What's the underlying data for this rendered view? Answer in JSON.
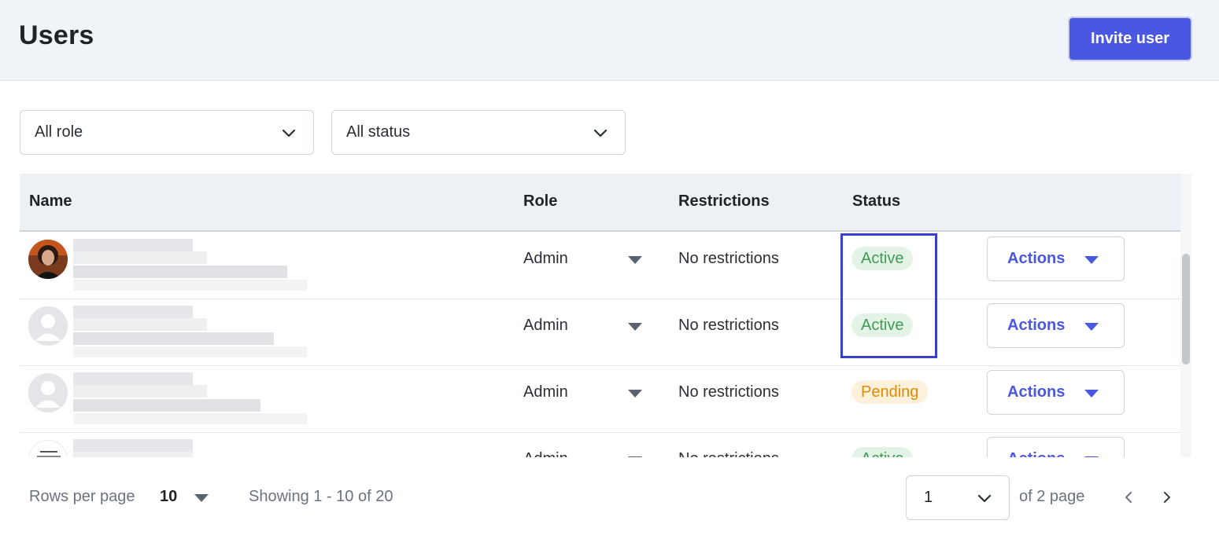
{
  "header": {
    "title": "Users",
    "invite_label": "Invite user"
  },
  "filters": {
    "role": "All role",
    "status": "All status"
  },
  "table": {
    "columns": {
      "name": "Name",
      "role": "Role",
      "restrictions": "Restrictions",
      "status": "Status"
    },
    "rows": [
      {
        "role": "Admin",
        "restrictions": "No restrictions",
        "status": "Active",
        "actions": "Actions",
        "avatar": "photo-avatar"
      },
      {
        "role": "Admin",
        "restrictions": "No restrictions",
        "status": "Active",
        "actions": "Actions",
        "avatar": "default-avatar"
      },
      {
        "role": "Admin",
        "restrictions": "No restrictions",
        "status": "Pending",
        "actions": "Actions",
        "avatar": "default-avatar"
      },
      {
        "role": "Admin",
        "restrictions": "No restrictions",
        "status": "Active",
        "actions": "Actions",
        "avatar": "logo-avatar"
      }
    ]
  },
  "footer": {
    "rows_per_page_label": "Rows per page",
    "rows_per_page_value": "10",
    "showing": "Showing 1 - 10 of 20",
    "current_page": "1",
    "of_pages": "of 2 page"
  },
  "colors": {
    "accent": "#4a57e0",
    "active": "#3f9b54",
    "pending": "#e08a00",
    "highlight": "#3940c9"
  },
  "icons": {
    "dropdown": "chevron-down-icon",
    "prev": "chevron-left-icon",
    "next": "chevron-right-icon",
    "caret": "caret-down-icon"
  }
}
